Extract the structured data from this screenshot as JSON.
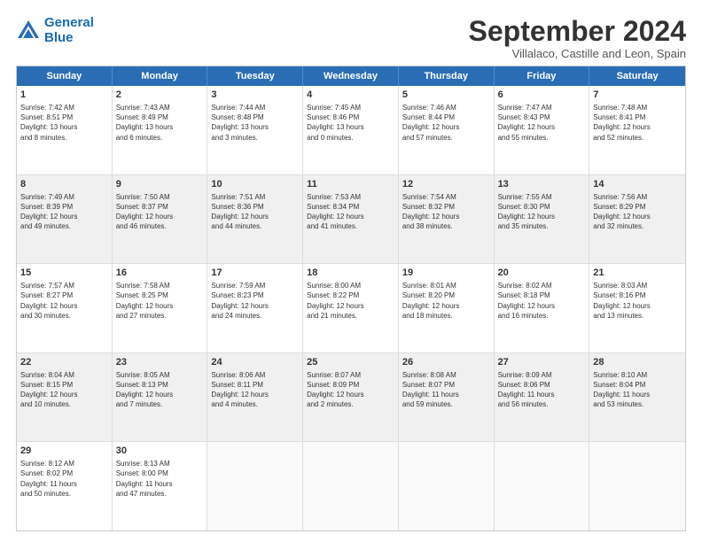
{
  "logo": {
    "line1": "General",
    "line2": "Blue"
  },
  "title": "September 2024",
  "subtitle": "Villalaco, Castille and Leon, Spain",
  "header": {
    "days": [
      "Sunday",
      "Monday",
      "Tuesday",
      "Wednesday",
      "Thursday",
      "Friday",
      "Saturday"
    ]
  },
  "rows": [
    [
      {
        "day": "1",
        "lines": [
          "Sunrise: 7:42 AM",
          "Sunset: 8:51 PM",
          "Daylight: 13 hours",
          "and 8 minutes."
        ]
      },
      {
        "day": "2",
        "lines": [
          "Sunrise: 7:43 AM",
          "Sunset: 8:49 PM",
          "Daylight: 13 hours",
          "and 6 minutes."
        ]
      },
      {
        "day": "3",
        "lines": [
          "Sunrise: 7:44 AM",
          "Sunset: 8:48 PM",
          "Daylight: 13 hours",
          "and 3 minutes."
        ]
      },
      {
        "day": "4",
        "lines": [
          "Sunrise: 7:45 AM",
          "Sunset: 8:46 PM",
          "Daylight: 13 hours",
          "and 0 minutes."
        ]
      },
      {
        "day": "5",
        "lines": [
          "Sunrise: 7:46 AM",
          "Sunset: 8:44 PM",
          "Daylight: 12 hours",
          "and 57 minutes."
        ]
      },
      {
        "day": "6",
        "lines": [
          "Sunrise: 7:47 AM",
          "Sunset: 8:43 PM",
          "Daylight: 12 hours",
          "and 55 minutes."
        ]
      },
      {
        "day": "7",
        "lines": [
          "Sunrise: 7:48 AM",
          "Sunset: 8:41 PM",
          "Daylight: 12 hours",
          "and 52 minutes."
        ]
      }
    ],
    [
      {
        "day": "8",
        "lines": [
          "Sunrise: 7:49 AM",
          "Sunset: 8:39 PM",
          "Daylight: 12 hours",
          "and 49 minutes."
        ],
        "shaded": true
      },
      {
        "day": "9",
        "lines": [
          "Sunrise: 7:50 AM",
          "Sunset: 8:37 PM",
          "Daylight: 12 hours",
          "and 46 minutes."
        ],
        "shaded": true
      },
      {
        "day": "10",
        "lines": [
          "Sunrise: 7:51 AM",
          "Sunset: 8:36 PM",
          "Daylight: 12 hours",
          "and 44 minutes."
        ],
        "shaded": true
      },
      {
        "day": "11",
        "lines": [
          "Sunrise: 7:53 AM",
          "Sunset: 8:34 PM",
          "Daylight: 12 hours",
          "and 41 minutes."
        ],
        "shaded": true
      },
      {
        "day": "12",
        "lines": [
          "Sunrise: 7:54 AM",
          "Sunset: 8:32 PM",
          "Daylight: 12 hours",
          "and 38 minutes."
        ],
        "shaded": true
      },
      {
        "day": "13",
        "lines": [
          "Sunrise: 7:55 AM",
          "Sunset: 8:30 PM",
          "Daylight: 12 hours",
          "and 35 minutes."
        ],
        "shaded": true
      },
      {
        "day": "14",
        "lines": [
          "Sunrise: 7:56 AM",
          "Sunset: 8:29 PM",
          "Daylight: 12 hours",
          "and 32 minutes."
        ],
        "shaded": true
      }
    ],
    [
      {
        "day": "15",
        "lines": [
          "Sunrise: 7:57 AM",
          "Sunset: 8:27 PM",
          "Daylight: 12 hours",
          "and 30 minutes."
        ]
      },
      {
        "day": "16",
        "lines": [
          "Sunrise: 7:58 AM",
          "Sunset: 8:25 PM",
          "Daylight: 12 hours",
          "and 27 minutes."
        ]
      },
      {
        "day": "17",
        "lines": [
          "Sunrise: 7:59 AM",
          "Sunset: 8:23 PM",
          "Daylight: 12 hours",
          "and 24 minutes."
        ]
      },
      {
        "day": "18",
        "lines": [
          "Sunrise: 8:00 AM",
          "Sunset: 8:22 PM",
          "Daylight: 12 hours",
          "and 21 minutes."
        ]
      },
      {
        "day": "19",
        "lines": [
          "Sunrise: 8:01 AM",
          "Sunset: 8:20 PM",
          "Daylight: 12 hours",
          "and 18 minutes."
        ]
      },
      {
        "day": "20",
        "lines": [
          "Sunrise: 8:02 AM",
          "Sunset: 8:18 PM",
          "Daylight: 12 hours",
          "and 16 minutes."
        ]
      },
      {
        "day": "21",
        "lines": [
          "Sunrise: 8:03 AM",
          "Sunset: 8:16 PM",
          "Daylight: 12 hours",
          "and 13 minutes."
        ]
      }
    ],
    [
      {
        "day": "22",
        "lines": [
          "Sunrise: 8:04 AM",
          "Sunset: 8:15 PM",
          "Daylight: 12 hours",
          "and 10 minutes."
        ],
        "shaded": true
      },
      {
        "day": "23",
        "lines": [
          "Sunrise: 8:05 AM",
          "Sunset: 8:13 PM",
          "Daylight: 12 hours",
          "and 7 minutes."
        ],
        "shaded": true
      },
      {
        "day": "24",
        "lines": [
          "Sunrise: 8:06 AM",
          "Sunset: 8:11 PM",
          "Daylight: 12 hours",
          "and 4 minutes."
        ],
        "shaded": true
      },
      {
        "day": "25",
        "lines": [
          "Sunrise: 8:07 AM",
          "Sunset: 8:09 PM",
          "Daylight: 12 hours",
          "and 2 minutes."
        ],
        "shaded": true
      },
      {
        "day": "26",
        "lines": [
          "Sunrise: 8:08 AM",
          "Sunset: 8:07 PM",
          "Daylight: 11 hours",
          "and 59 minutes."
        ],
        "shaded": true
      },
      {
        "day": "27",
        "lines": [
          "Sunrise: 8:09 AM",
          "Sunset: 8:06 PM",
          "Daylight: 11 hours",
          "and 56 minutes."
        ],
        "shaded": true
      },
      {
        "day": "28",
        "lines": [
          "Sunrise: 8:10 AM",
          "Sunset: 8:04 PM",
          "Daylight: 11 hours",
          "and 53 minutes."
        ],
        "shaded": true
      }
    ],
    [
      {
        "day": "29",
        "lines": [
          "Sunrise: 8:12 AM",
          "Sunset: 8:02 PM",
          "Daylight: 11 hours",
          "and 50 minutes."
        ]
      },
      {
        "day": "30",
        "lines": [
          "Sunrise: 8:13 AM",
          "Sunset: 8:00 PM",
          "Daylight: 11 hours",
          "and 47 minutes."
        ]
      },
      {
        "day": "",
        "lines": [],
        "empty": true
      },
      {
        "day": "",
        "lines": [],
        "empty": true
      },
      {
        "day": "",
        "lines": [],
        "empty": true
      },
      {
        "day": "",
        "lines": [],
        "empty": true
      },
      {
        "day": "",
        "lines": [],
        "empty": true
      }
    ]
  ]
}
